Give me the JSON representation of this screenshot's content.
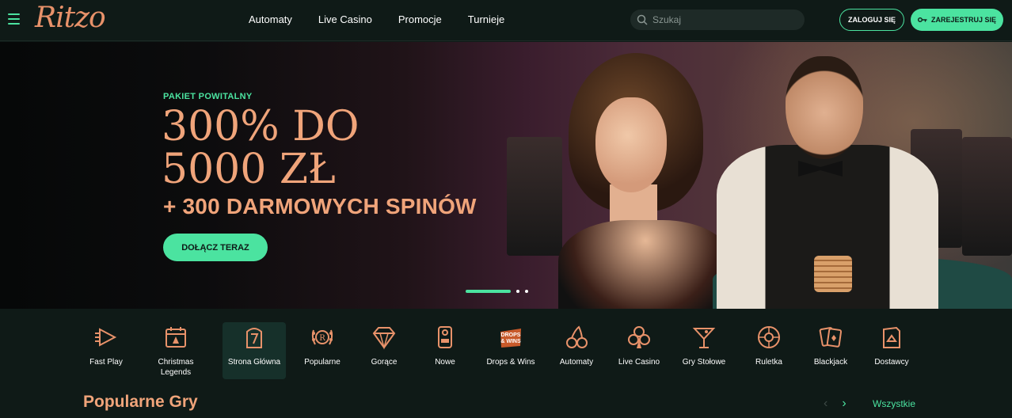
{
  "brand": {
    "logo_text": "Ritzo",
    "accent": "#4be3a0",
    "gold": "#f0a47a"
  },
  "nav": {
    "items": [
      {
        "label": "Automaty"
      },
      {
        "label": "Live Casino"
      },
      {
        "label": "Promocje"
      },
      {
        "label": "Turnieje"
      }
    ]
  },
  "search": {
    "placeholder": "Szukaj",
    "value": ""
  },
  "auth": {
    "login_label": "ZALOGUJ SIĘ",
    "register_label": "ZAREJESTRUJ SIĘ"
  },
  "hero": {
    "kicker": "PAKIET POWITALNY",
    "line1": "300% DO",
    "line2": "5000 ZŁ",
    "line3": "+ 300 DARMOWYCH SPINÓW",
    "cta_label": "DOŁĄCZ TERAZ",
    "slides_total": 3,
    "slide_active": 1
  },
  "categories": {
    "items": [
      {
        "label": "Fast Play",
        "icon": "play-arrow-icon"
      },
      {
        "label": "Christmas Legends",
        "icon": "calendar-icon"
      },
      {
        "label": "Strona Główna",
        "icon": "slot-seven-icon",
        "active": true
      },
      {
        "label": "Popularne",
        "icon": "laurel-badge-icon"
      },
      {
        "label": "Gorące",
        "icon": "diamond-icon"
      },
      {
        "label": "Nowe",
        "icon": "door-tag-icon"
      },
      {
        "label": "Drops & Wins",
        "icon": "drops-wins-badge-icon"
      },
      {
        "label": "Automaty",
        "icon": "cherries-icon"
      },
      {
        "label": "Live Casino",
        "icon": "club-icon"
      },
      {
        "label": "Gry Stołowe",
        "icon": "cocktail-icon"
      },
      {
        "label": "Ruletka",
        "icon": "roulette-icon"
      },
      {
        "label": "Blackjack",
        "icon": "cards-icon"
      },
      {
        "label": "Dostawcy",
        "icon": "provider-chip-icon"
      }
    ],
    "drops_badge_text": [
      "DROPS",
      "& WINS"
    ]
  },
  "popular": {
    "title": "Popularne Gry",
    "all_label": "Wszystkie"
  }
}
